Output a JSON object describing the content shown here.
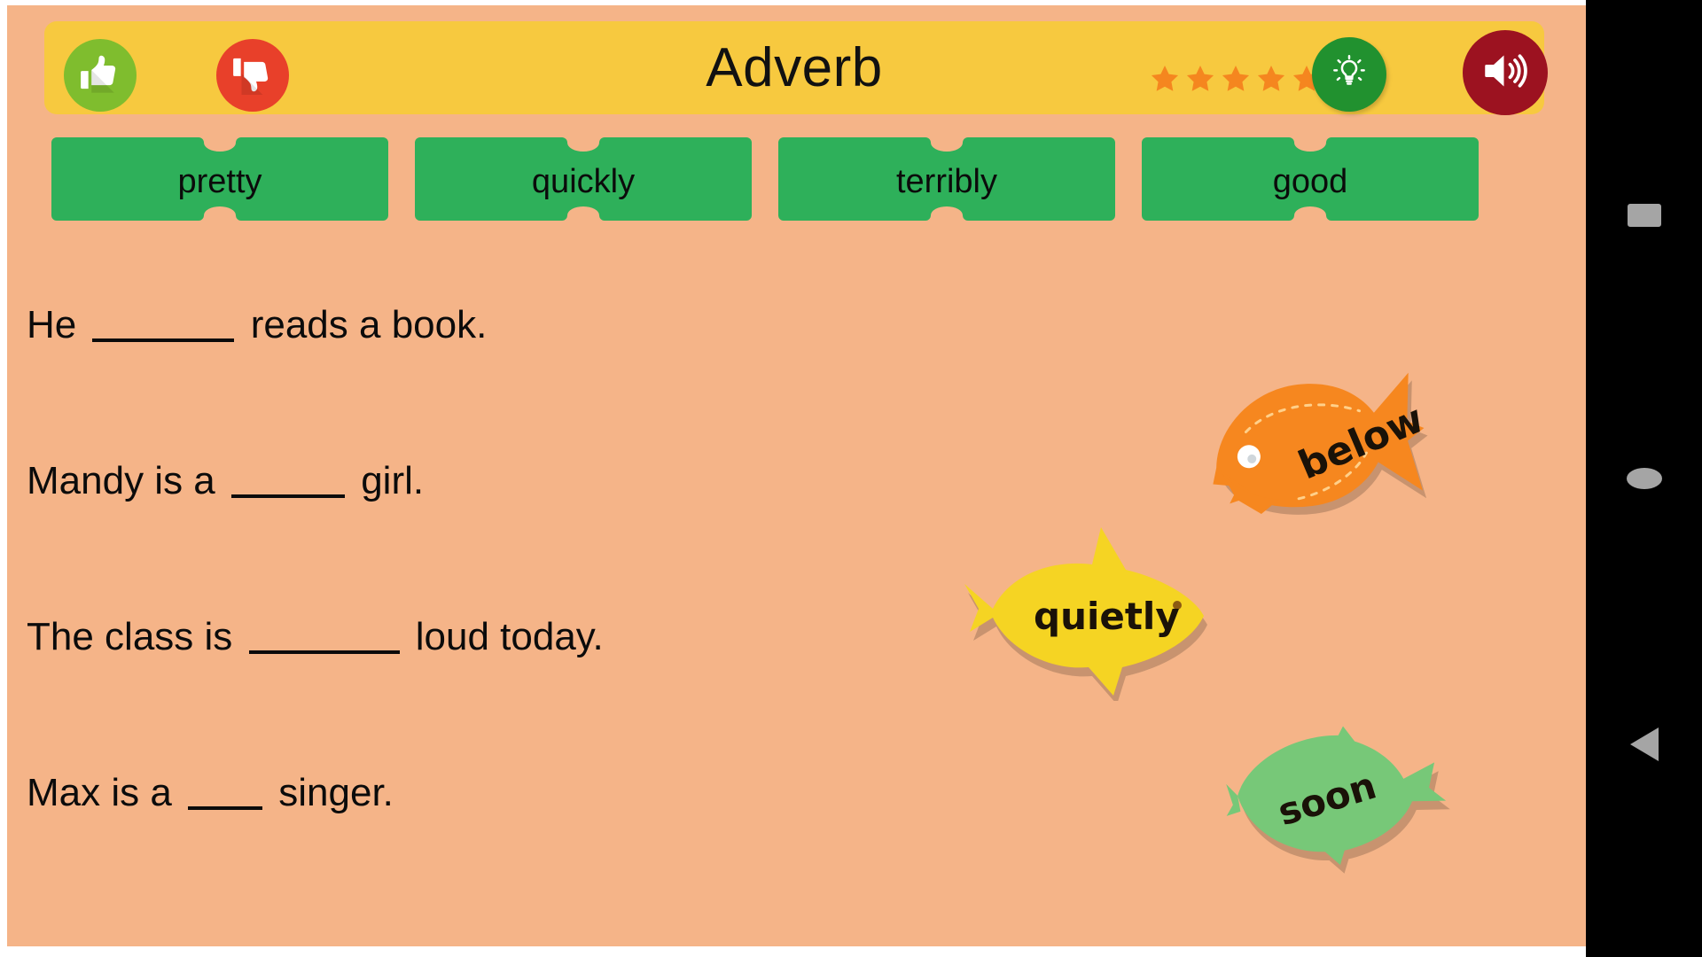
{
  "app": {
    "title": "Adverb",
    "background_color": "#f5b488",
    "header_color": "#f7c93f"
  },
  "header": {
    "title": "Adverb",
    "thumbs_up": {
      "name": "thumbs-up",
      "color": "#7fbd2e"
    },
    "thumbs_down": {
      "name": "thumbs-down",
      "color": "#e8402a"
    },
    "hint": {
      "name": "lightbulb",
      "color": "#21912f"
    },
    "sound": {
      "name": "speaker",
      "color": "#9c1220"
    },
    "stars": {
      "count": 5,
      "filled": 5,
      "color": "#f5861f"
    }
  },
  "tiles": [
    {
      "label": "pretty",
      "color": "#2eb05a"
    },
    {
      "label": "quickly",
      "color": "#2eb05a"
    },
    {
      "label": "terribly",
      "color": "#2eb05a"
    },
    {
      "label": "good",
      "color": "#2eb05a"
    }
  ],
  "sentences": [
    {
      "before": "He ",
      "blank_width": 160,
      "after": " reads a book."
    },
    {
      "before": "Mandy is a ",
      "blank_width": 128,
      "after": " girl."
    },
    {
      "before": "The class is ",
      "blank_width": 170,
      "after": " loud today."
    },
    {
      "before": "Max is a ",
      "blank_width": 84,
      "after": " singer."
    }
  ],
  "fish": [
    {
      "word": "below",
      "color": "#f6871f",
      "name": "fish-below"
    },
    {
      "word": "quietly",
      "color": "#f5d423",
      "name": "fish-quietly"
    },
    {
      "word": "soon",
      "color": "#77c878",
      "name": "fish-soon"
    }
  ],
  "navbar": {
    "recents": "recents",
    "home": "home",
    "back": "back",
    "icon_color": "#a5a5a5"
  }
}
